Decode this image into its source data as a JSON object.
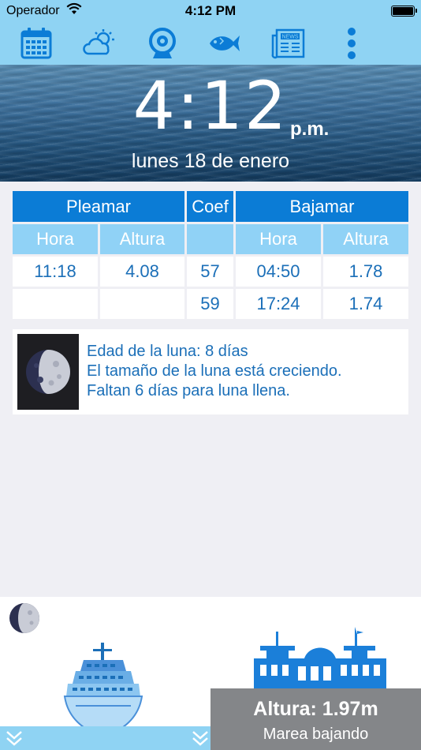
{
  "status_bar": {
    "carrier": "Operador",
    "time": "4:12 PM"
  },
  "toolbar": {
    "icons": [
      "calendar-icon",
      "weather-icon",
      "webcam-icon",
      "fish-icon",
      "news-icon",
      "more-icon"
    ],
    "news_label": "NEWS"
  },
  "clock": {
    "time": "4:12",
    "ampm": "p.m.",
    "date": "lunes 18 de enero"
  },
  "tide": {
    "pleamar": "Pleamar",
    "coef": "Coef",
    "bajamar": "Bajamar",
    "hora": "Hora",
    "altura": "Altura",
    "rows": [
      {
        "high_time": "11:18",
        "high_height": "4.08",
        "coef": "57",
        "low_time": "04:50",
        "low_height": "1.78"
      },
      {
        "high_time": "",
        "high_height": "",
        "coef": "59",
        "low_time": "17:24",
        "low_height": "1.74"
      }
    ]
  },
  "moon": {
    "line1": "Edad de la luna: 8 días",
    "line2": "El tamaño de la luna está creciendo.",
    "line3": "Faltan 6 días para luna llena."
  },
  "current": {
    "altura": "Altura:  1.97m",
    "trend": "Marea bajando"
  },
  "colors": {
    "bar": "#8fd3f3",
    "header_blue": "#0b7cd6",
    "sub_blue": "#90d2f6",
    "text_blue": "#1b6fb8"
  }
}
